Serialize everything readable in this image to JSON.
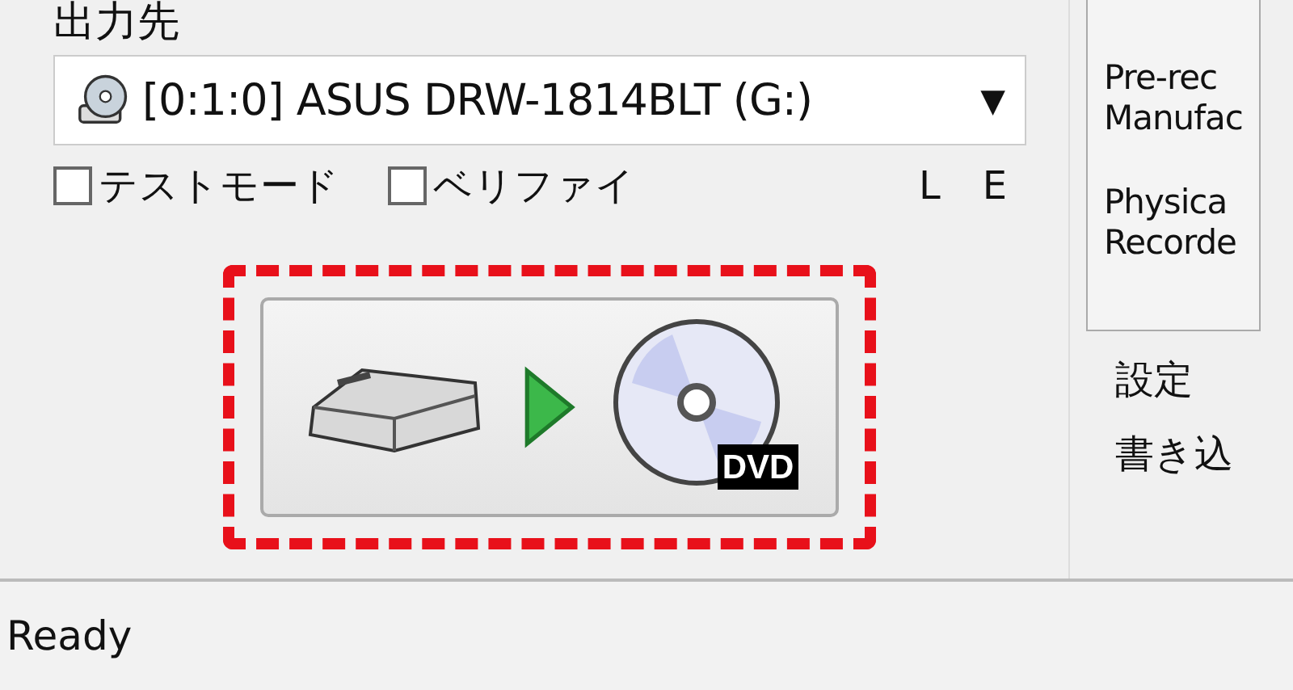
{
  "output": {
    "label": "出力先",
    "device": "[0:1:0] ASUS DRW-1814BLT (G:)",
    "arrow": "▼",
    "options": [
      {
        "label": "テストモード",
        "checked": false
      },
      {
        "label": "ベリファイ",
        "checked": false
      }
    ],
    "flags": [
      "L",
      "E"
    ]
  },
  "info_panel": {
    "lines": [
      [
        "Pre-rec",
        "Manufac"
      ],
      [
        "Physica",
        "Recorde"
      ]
    ]
  },
  "side_labels": [
    "設定",
    "書き込"
  ],
  "burn_button": {
    "highlighted": true,
    "disc_label": "DVD"
  },
  "status_bar": {
    "text": "Ready"
  }
}
